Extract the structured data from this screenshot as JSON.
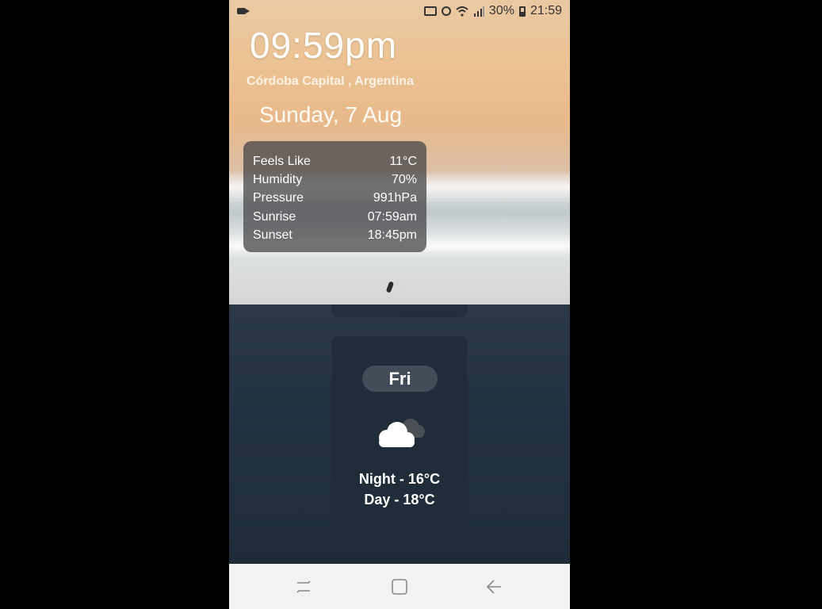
{
  "status_bar": {
    "battery": "30%",
    "time": "21:59",
    "icons": [
      "screen-record-icon",
      "cast-icon",
      "alarm-icon",
      "wifi-icon",
      "signal-icon",
      "battery-icon"
    ]
  },
  "header": {
    "clock": "09:59pm",
    "location": "Córdoba Capital , Argentina",
    "date": "Sunday, 7 Aug"
  },
  "details": [
    {
      "label": "Feels Like",
      "value": "11°C"
    },
    {
      "label": "Humidity",
      "value": "70%"
    },
    {
      "label": "Pressure",
      "value": "991hPa"
    },
    {
      "label": "Sunrise",
      "value": "07:59am"
    },
    {
      "label": "Sunset",
      "value": "18:45pm"
    }
  ],
  "forecast": {
    "day": "Fri",
    "icon": "cloudy-icon",
    "night": "Night - 16°C",
    "day_temp": "Day - 18°C"
  },
  "nav_bar": {
    "buttons": [
      "recent-apps-icon",
      "home-icon",
      "back-icon"
    ]
  },
  "colors": {
    "background": "#000000",
    "ocean": "#233242",
    "card": "#202c3a",
    "nav": "#f2f2f2"
  }
}
